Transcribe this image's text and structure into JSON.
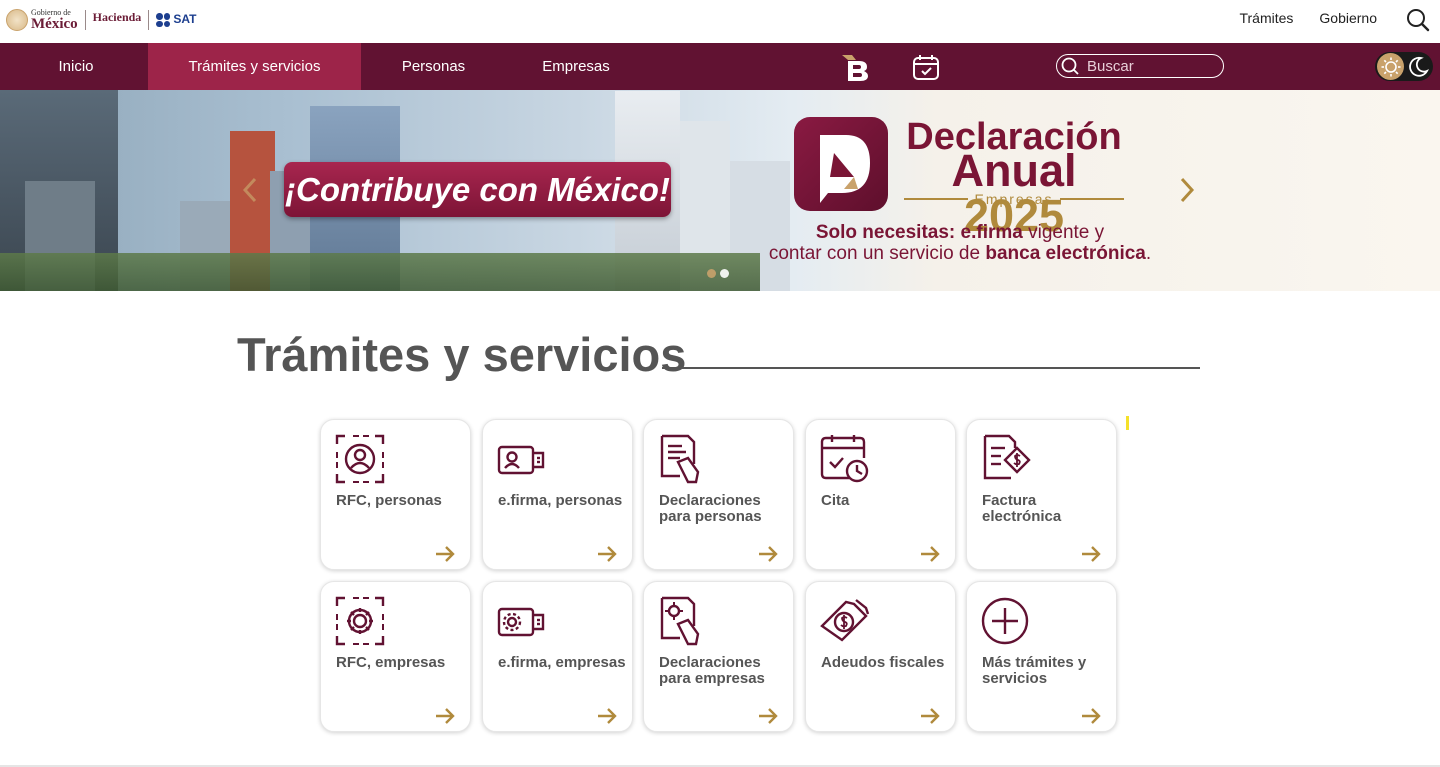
{
  "header": {
    "gob_small": "Gobierno de",
    "gob_big": "México",
    "hacienda": "Hacienda",
    "sat": "SAT",
    "links": [
      "Trámites",
      "Gobierno"
    ]
  },
  "nav": {
    "items": [
      "Inicio",
      "Trámites y servicios",
      "Personas",
      "Empresas"
    ],
    "active_index": 1,
    "search_placeholder": "Buscar"
  },
  "hero": {
    "contrib_prefix": "¡Contribuye con",
    "contrib_highlight": "México!",
    "decl_title_line1": "Declaración",
    "decl_title_word": "Anual",
    "decl_title_year": "2025",
    "decl_sub": "Empresas",
    "decl_line1_bold": "Solo necesitas:",
    "decl_line1_bold2": "e.firma",
    "decl_line1_rest": "vigente y",
    "decl_line2_pre": "contar con un servicio de",
    "decl_line2_bold": "banca electrónica",
    "decl_line2_post": ".",
    "slides": 2,
    "active_slide": 0
  },
  "section": {
    "title": "Trámites y servicios"
  },
  "cards": [
    {
      "label": "RFC, personas",
      "icon": "rfc-person-icon"
    },
    {
      "label": "e.firma, personas",
      "icon": "efirma-person-icon"
    },
    {
      "label": "Declaraciones para personas",
      "icon": "declaration-person-icon"
    },
    {
      "label": "Cita",
      "icon": "calendar-clock-icon"
    },
    {
      "label": "Factura electrónica",
      "icon": "invoice-icon"
    },
    {
      "label": "RFC, empresas",
      "icon": "rfc-company-icon"
    },
    {
      "label": "e.firma, empresas",
      "icon": "efirma-company-icon"
    },
    {
      "label": "Declaraciones para empresas",
      "icon": "declaration-company-icon"
    },
    {
      "label": "Adeudos fiscales",
      "icon": "tax-debt-icon"
    },
    {
      "label": "Más trámites y servicios",
      "icon": "plus-circle-icon"
    }
  ],
  "colors": {
    "primary": "#611232",
    "nav_active": "#9d2449",
    "accent_gold": "#b08a3c",
    "icon_color": "#611232",
    "text_gray": "#555555"
  }
}
